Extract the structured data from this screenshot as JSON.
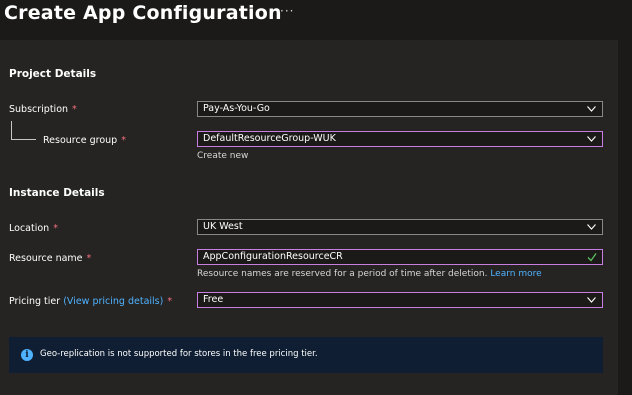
{
  "page": {
    "title": "Create App Configuration",
    "more_glyph": "···"
  },
  "project_details": {
    "heading": "Project Details",
    "subscription": {
      "label": "Subscription",
      "required": "*",
      "value": "Pay-As-You-Go"
    },
    "resource_group": {
      "label": "Resource group",
      "required": "*",
      "value": "DefaultResourceGroup-WUK",
      "create_new": "Create new"
    }
  },
  "instance_details": {
    "heading": "Instance Details",
    "location": {
      "label": "Location",
      "required": "*",
      "value": "UK West"
    },
    "resource_name": {
      "label": "Resource name",
      "required": "*",
      "value": "AppConfigurationResourceCR",
      "hint": "Resource names are reserved for a period of time after deletion.",
      "learn_more": "Learn more"
    },
    "pricing_tier": {
      "label": "Pricing tier",
      "link": "(View pricing details)",
      "required": "*",
      "value": "Free"
    }
  },
  "info_banner": {
    "icon_glyph": "i",
    "text": "Geo-replication is not supported for stores in the free pricing tier."
  },
  "colors": {
    "background": "#1b1a19",
    "panel": "#252423",
    "accent_link": "#4fb2ff",
    "focus_border": "#c87ee0",
    "required": "#f1707b",
    "valid_check": "#57c05c",
    "info_background": "#0f1e33"
  }
}
